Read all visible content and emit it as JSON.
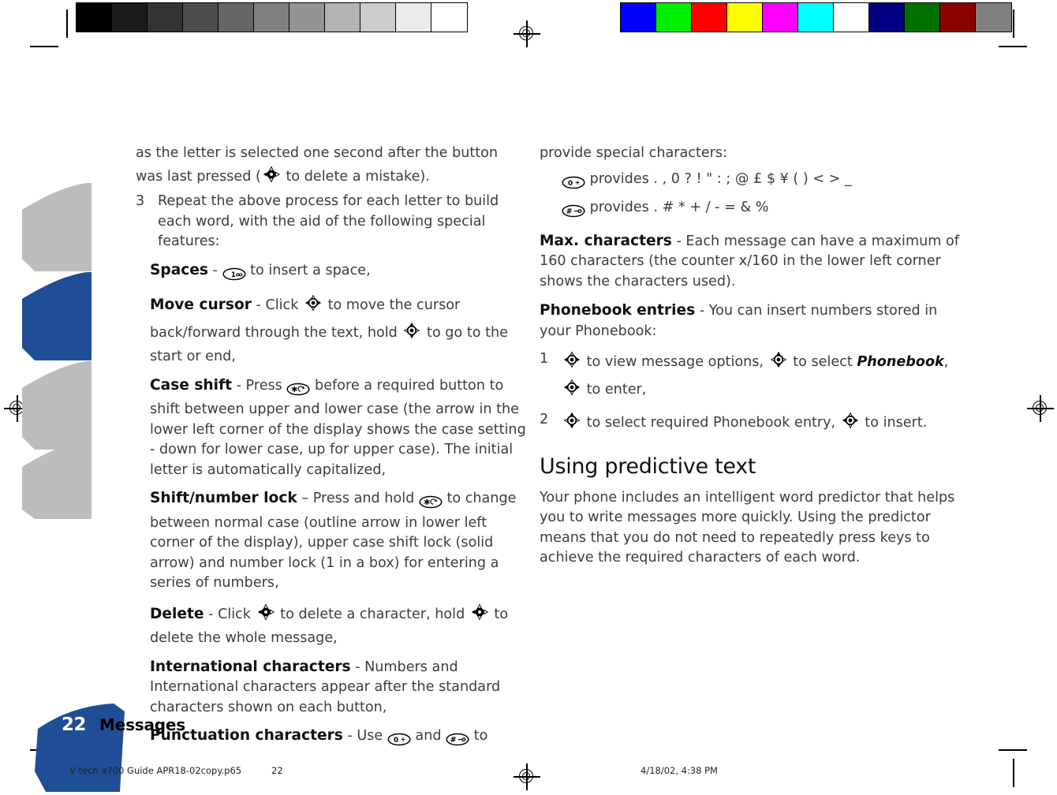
{
  "calibration": {
    "gray_bar": {
      "name": "grayscale-calibration-bar",
      "swatches": [
        "#000000",
        "#1a1a1a",
        "#333333",
        "#4d4d4d",
        "#666666",
        "#808080",
        "#949494",
        "#b3b3b3",
        "#cccccc",
        "#eaeaea",
        "#ffffff"
      ]
    },
    "color_bar": {
      "name": "color-calibration-bar",
      "swatches": [
        "#0000ff",
        "#00ee00",
        "#ff0000",
        "#ffff00",
        "#ff00ff",
        "#00ffff",
        "#ffffff",
        "#000080",
        "#007000",
        "#8b0000",
        "#808080"
      ]
    }
  },
  "accent_color": "#1f4e96",
  "tab_gray": "#b9b9b9",
  "left_column": {
    "continued_paragraph": "as the letter is selected one second after the button was last pressed (",
    "continued_paragraph_end": " to delete a mistake).",
    "step": {
      "number": "3",
      "text": "Repeat the above process for each letter to build each word, with the aid of the following special features:"
    },
    "features": [
      {
        "term": "Spaces",
        "dash": "-",
        "before_icon": "",
        "icon": "key-1",
        "after_icon": " to insert a space,"
      },
      {
        "term": "Move cursor",
        "dash": "-",
        "before_icon": " Click ",
        "icon": "joystick-left-right",
        "after_icon": " to move the cursor back/forward through the text, hold ",
        "icon2": "joystick-up-down",
        "tail": " to go to the start or end,"
      },
      {
        "term": "Case shift",
        "dash": "-",
        "before_icon": " Press ",
        "icon": "key-star",
        "after_icon": " before a required button to shift between upper and lower case (the arrow in the lower left corner of the display shows the case setting - down for lower case, up for upper case). The initial letter is automatically capitalized,"
      },
      {
        "term": "Shift/number lock",
        "dash": "–",
        "before_icon": " Press and hold ",
        "icon": "key-star",
        "after_icon": " to change between normal case (outline arrow in lower left corner of the display), upper case shift lock (solid arrow) and number lock (1 in a box) for entering a series of numbers,"
      },
      {
        "term": "Delete",
        "dash": "-",
        "before_icon": " Click ",
        "icon": "joystick-left",
        "after_icon": " to delete a character, hold ",
        "icon2": "joystick-left",
        "tail": " to delete the whole message,"
      },
      {
        "term": "International characters",
        "dash": "-",
        "before_icon": "",
        "icon": "",
        "after_icon": " Numbers and International characters appear after the standard characters shown on each button,"
      },
      {
        "term": "Punctuation characters",
        "dash": "-",
        "before_icon": " Use ",
        "icon": "key-0",
        "after_icon": " and ",
        "icon2": "key-hash",
        "tail": " to"
      }
    ]
  },
  "right_column": {
    "continued_paragraph": "provide special characters:",
    "char_rows": [
      {
        "icon": "key-0",
        "text": "provides . , 0 ? ! \" : ; @ £ $ ¥ ( ) < > _"
      },
      {
        "icon": "key-hash",
        "text": "provides . # * + / - = & %"
      }
    ],
    "features": [
      {
        "term": "Max. characters",
        "dash": "-",
        "text": " Each message can have a maximum of 160 characters (the counter x/160 in the lower left corner shows the characters used)."
      },
      {
        "term": "Phonebook entries",
        "dash": "-",
        "text": " You can insert numbers stored in your Phonebook:"
      }
    ],
    "steps": [
      {
        "number": "1",
        "icon": "joystick-left-right",
        "text_a": " to view message options, ",
        "icon2": "joystick-up-down",
        "text_b": " to select ",
        "emphasis": "Phonebook",
        "text_c": ", ",
        "icon3": "joystick-left-right",
        "text_d": " to enter,"
      },
      {
        "number": "2",
        "icon": "joystick-up-down",
        "text_a": " to select required Phonebook entry, ",
        "icon2": "joystick-left-right",
        "text_b": " to insert."
      }
    ],
    "section_heading": "Using predictive text",
    "section_body": "Your phone includes an intelligent word predictor that helps you to write messages more quickly. Using the predictor means that you do not need to repeatedly press keys to achieve the required characters of each word."
  },
  "footer": {
    "page_number": "22",
    "section_title": "Messages",
    "print_filename": "V tech a700 Guide APR18-02copy.p65",
    "print_page": "22",
    "print_timestamp": "4/18/02, 4:38 PM"
  }
}
